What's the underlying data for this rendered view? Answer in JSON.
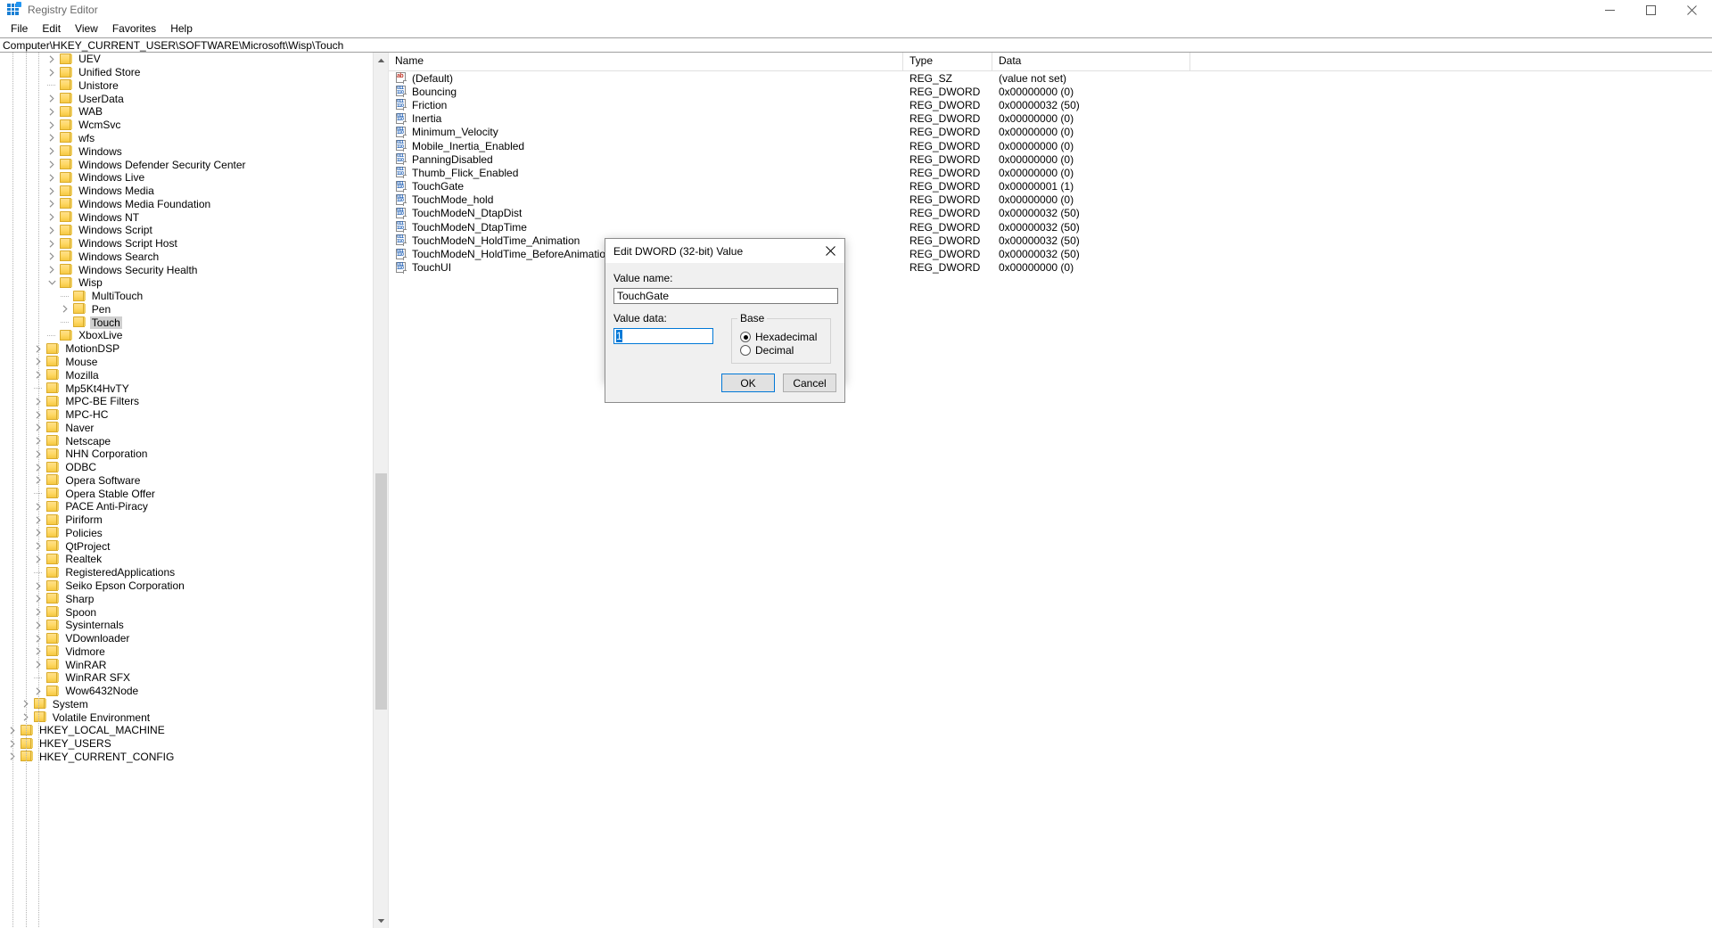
{
  "window": {
    "title": "Registry Editor",
    "icon": "registry-editor-icon",
    "minimize_label": "─",
    "maximize_label": "□",
    "close_label": "✕"
  },
  "menubar": {
    "items": [
      {
        "label": "File"
      },
      {
        "label": "Edit"
      },
      {
        "label": "View"
      },
      {
        "label": "Favorites"
      },
      {
        "label": "Help"
      }
    ]
  },
  "address": {
    "path": "Computer\\HKEY_CURRENT_USER\\SOFTWARE\\Microsoft\\Wisp\\Touch"
  },
  "tree": {
    "rows": [
      {
        "label": "UEV",
        "depth": 4,
        "expander": "collapsed",
        "selected": false
      },
      {
        "label": "Unified Store",
        "depth": 4,
        "expander": "collapsed",
        "selected": false
      },
      {
        "label": "Unistore",
        "depth": 4,
        "expander": "leaf",
        "selected": false
      },
      {
        "label": "UserData",
        "depth": 4,
        "expander": "collapsed",
        "selected": false
      },
      {
        "label": "WAB",
        "depth": 4,
        "expander": "collapsed",
        "selected": false
      },
      {
        "label": "WcmSvc",
        "depth": 4,
        "expander": "collapsed",
        "selected": false
      },
      {
        "label": "wfs",
        "depth": 4,
        "expander": "collapsed",
        "selected": false
      },
      {
        "label": "Windows",
        "depth": 4,
        "expander": "collapsed",
        "selected": false
      },
      {
        "label": "Windows Defender Security Center",
        "depth": 4,
        "expander": "collapsed",
        "selected": false
      },
      {
        "label": "Windows Live",
        "depth": 4,
        "expander": "collapsed",
        "selected": false
      },
      {
        "label": "Windows Media",
        "depth": 4,
        "expander": "collapsed",
        "selected": false
      },
      {
        "label": "Windows Media Foundation",
        "depth": 4,
        "expander": "collapsed",
        "selected": false
      },
      {
        "label": "Windows NT",
        "depth": 4,
        "expander": "collapsed",
        "selected": false
      },
      {
        "label": "Windows Script",
        "depth": 4,
        "expander": "collapsed",
        "selected": false
      },
      {
        "label": "Windows Script Host",
        "depth": 4,
        "expander": "collapsed",
        "selected": false
      },
      {
        "label": "Windows Search",
        "depth": 4,
        "expander": "collapsed",
        "selected": false
      },
      {
        "label": "Windows Security Health",
        "depth": 4,
        "expander": "collapsed",
        "selected": false
      },
      {
        "label": "Wisp",
        "depth": 4,
        "expander": "expanded",
        "selected": false
      },
      {
        "label": "MultiTouch",
        "depth": 5,
        "expander": "leaf",
        "selected": false
      },
      {
        "label": "Pen",
        "depth": 5,
        "expander": "collapsed",
        "selected": false
      },
      {
        "label": "Touch",
        "depth": 5,
        "expander": "leaf",
        "selected": true
      },
      {
        "label": "XboxLive",
        "depth": 4,
        "expander": "leaf",
        "selected": false
      },
      {
        "label": "MotionDSP",
        "depth": 3,
        "expander": "collapsed",
        "selected": false
      },
      {
        "label": "Mouse",
        "depth": 3,
        "expander": "collapsed",
        "selected": false
      },
      {
        "label": "Mozilla",
        "depth": 3,
        "expander": "collapsed",
        "selected": false
      },
      {
        "label": "Mp5Kt4HvTY",
        "depth": 3,
        "expander": "leaf",
        "selected": false
      },
      {
        "label": "MPC-BE Filters",
        "depth": 3,
        "expander": "collapsed",
        "selected": false
      },
      {
        "label": "MPC-HC",
        "depth": 3,
        "expander": "collapsed",
        "selected": false
      },
      {
        "label": "Naver",
        "depth": 3,
        "expander": "collapsed",
        "selected": false
      },
      {
        "label": "Netscape",
        "depth": 3,
        "expander": "collapsed",
        "selected": false
      },
      {
        "label": "NHN Corporation",
        "depth": 3,
        "expander": "collapsed",
        "selected": false
      },
      {
        "label": "ODBC",
        "depth": 3,
        "expander": "collapsed",
        "selected": false
      },
      {
        "label": "Opera Software",
        "depth": 3,
        "expander": "collapsed",
        "selected": false
      },
      {
        "label": "Opera Stable Offer",
        "depth": 3,
        "expander": "leaf",
        "selected": false
      },
      {
        "label": "PACE Anti-Piracy",
        "depth": 3,
        "expander": "collapsed",
        "selected": false
      },
      {
        "label": "Piriform",
        "depth": 3,
        "expander": "collapsed",
        "selected": false
      },
      {
        "label": "Policies",
        "depth": 3,
        "expander": "collapsed",
        "selected": false
      },
      {
        "label": "QtProject",
        "depth": 3,
        "expander": "collapsed",
        "selected": false
      },
      {
        "label": "Realtek",
        "depth": 3,
        "expander": "collapsed",
        "selected": false
      },
      {
        "label": "RegisteredApplications",
        "depth": 3,
        "expander": "leaf",
        "selected": false
      },
      {
        "label": "Seiko Epson Corporation",
        "depth": 3,
        "expander": "collapsed",
        "selected": false
      },
      {
        "label": "Sharp",
        "depth": 3,
        "expander": "collapsed",
        "selected": false
      },
      {
        "label": "Spoon",
        "depth": 3,
        "expander": "collapsed",
        "selected": false
      },
      {
        "label": "Sysinternals",
        "depth": 3,
        "expander": "collapsed",
        "selected": false
      },
      {
        "label": "VDownloader",
        "depth": 3,
        "expander": "collapsed",
        "selected": false
      },
      {
        "label": "Vidmore",
        "depth": 3,
        "expander": "collapsed",
        "selected": false
      },
      {
        "label": "WinRAR",
        "depth": 3,
        "expander": "collapsed",
        "selected": false
      },
      {
        "label": "WinRAR SFX",
        "depth": 3,
        "expander": "leaf",
        "selected": false
      },
      {
        "label": "Wow6432Node",
        "depth": 3,
        "expander": "collapsed",
        "selected": false
      },
      {
        "label": "System",
        "depth": 2,
        "expander": "collapsed",
        "selected": false
      },
      {
        "label": "Volatile Environment",
        "depth": 2,
        "expander": "collapsed",
        "selected": false
      },
      {
        "label": "HKEY_LOCAL_MACHINE",
        "depth": 1,
        "expander": "collapsed",
        "selected": false
      },
      {
        "label": "HKEY_USERS",
        "depth": 1,
        "expander": "collapsed",
        "selected": false
      },
      {
        "label": "HKEY_CURRENT_CONFIG",
        "depth": 1,
        "expander": "collapsed",
        "selected": false
      }
    ]
  },
  "list": {
    "columns": {
      "name": "Name",
      "type": "Type",
      "data": "Data"
    },
    "rows": [
      {
        "name": "(Default)",
        "icon": "string-value-icon",
        "type": "REG_SZ",
        "data": "(value not set)"
      },
      {
        "name": "Bouncing",
        "icon": "dword-value-icon",
        "type": "REG_DWORD",
        "data": "0x00000000 (0)"
      },
      {
        "name": "Friction",
        "icon": "dword-value-icon",
        "type": "REG_DWORD",
        "data": "0x00000032 (50)"
      },
      {
        "name": "Inertia",
        "icon": "dword-value-icon",
        "type": "REG_DWORD",
        "data": "0x00000000 (0)"
      },
      {
        "name": "Minimum_Velocity",
        "icon": "dword-value-icon",
        "type": "REG_DWORD",
        "data": "0x00000000 (0)"
      },
      {
        "name": "Mobile_Inertia_Enabled",
        "icon": "dword-value-icon",
        "type": "REG_DWORD",
        "data": "0x00000000 (0)"
      },
      {
        "name": "PanningDisabled",
        "icon": "dword-value-icon",
        "type": "REG_DWORD",
        "data": "0x00000000 (0)"
      },
      {
        "name": "Thumb_Flick_Enabled",
        "icon": "dword-value-icon",
        "type": "REG_DWORD",
        "data": "0x00000000 (0)"
      },
      {
        "name": "TouchGate",
        "icon": "dword-value-icon",
        "type": "REG_DWORD",
        "data": "0x00000001 (1)"
      },
      {
        "name": "TouchMode_hold",
        "icon": "dword-value-icon",
        "type": "REG_DWORD",
        "data": "0x00000000 (0)"
      },
      {
        "name": "TouchModeN_DtapDist",
        "icon": "dword-value-icon",
        "type": "REG_DWORD",
        "data": "0x00000032 (50)"
      },
      {
        "name": "TouchModeN_DtapTime",
        "icon": "dword-value-icon",
        "type": "REG_DWORD",
        "data": "0x00000032 (50)"
      },
      {
        "name": "TouchModeN_HoldTime_Animation",
        "icon": "dword-value-icon",
        "type": "REG_DWORD",
        "data": "0x00000032 (50)"
      },
      {
        "name": "TouchModeN_HoldTime_BeforeAnimation",
        "icon": "dword-value-icon",
        "type": "REG_DWORD",
        "data": "0x00000032 (50)"
      },
      {
        "name": "TouchUI",
        "icon": "dword-value-icon",
        "type": "REG_DWORD",
        "data": "0x00000000 (0)"
      }
    ]
  },
  "dialog": {
    "title": "Edit DWORD (32-bit) Value",
    "close_label": "✕",
    "value_name_label": "Value name:",
    "value_name": "TouchGate",
    "value_data_label": "Value data:",
    "value_data": "1",
    "base_legend": "Base",
    "base_options": [
      {
        "label": "Hexadecimal",
        "checked": true
      },
      {
        "label": "Decimal",
        "checked": false
      }
    ],
    "ok_label": "OK",
    "cancel_label": "Cancel"
  }
}
